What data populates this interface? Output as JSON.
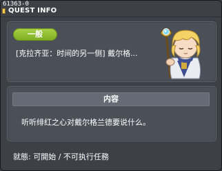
{
  "window": {
    "id_label": "61363-0",
    "title": "QUEST INFO"
  },
  "quest": {
    "category": "一般",
    "title": "[克拉齐亚：时间的另一侧] 戴尔格...",
    "npc_icon": "npc-portrait-icon"
  },
  "content": {
    "header": "内容",
    "text": "听听绯红之心对戴尔格兰德要说什么。"
  },
  "status": {
    "text": "就態: 可開始 / 不可执行任務"
  },
  "colors": {
    "background": "#3d4147",
    "panel": "#4b5058",
    "badge_green": "#8fbe31",
    "content_header": "#656b74"
  }
}
